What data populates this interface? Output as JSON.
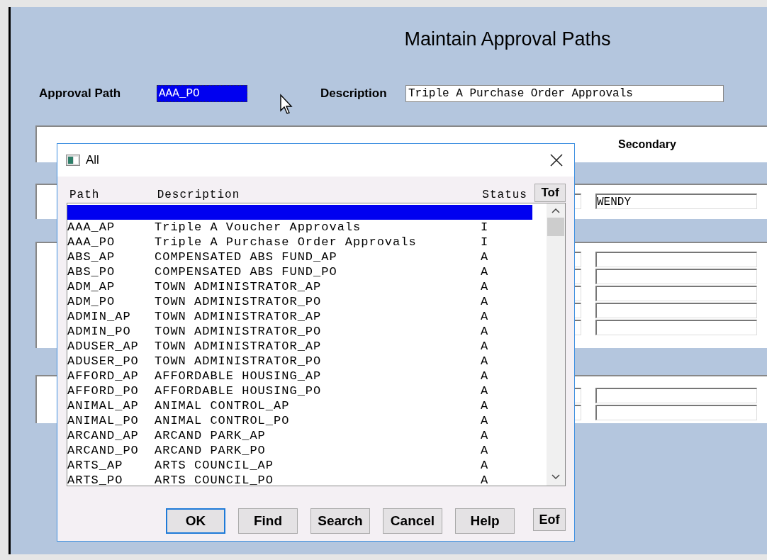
{
  "form": {
    "title": "Maintain Approval Paths",
    "approval_path": {
      "label": "Approval Path",
      "value": "AAA_PO",
      "selected": true
    },
    "description": {
      "label": "Description",
      "value": "Triple A Purchase Order Approvals"
    },
    "secondary_header": "Secondary",
    "secondary_value": "WENDY"
  },
  "dialog": {
    "title": "All",
    "columns": [
      "Path",
      "Description",
      "Status"
    ],
    "tof": "Tof",
    "rows": [
      {
        "selected": true
      },
      {
        "path": "AAA_AP",
        "description": "Triple A Voucher Approvals",
        "status": "I",
        "selected": false
      },
      {
        "path": "AAA_PO",
        "description": "Triple A Purchase Order Approvals",
        "status": "I",
        "selected": false
      },
      {
        "path": "ABS_AP",
        "description": "COMPENSATED ABS FUND_AP",
        "status": "A",
        "selected": false
      },
      {
        "path": "ABS_PO",
        "description": "COMPENSATED ABS FUND_PO",
        "status": "A",
        "selected": false
      },
      {
        "path": "ADM_AP",
        "description": "TOWN ADMINISTRATOR_AP",
        "status": "A",
        "selected": false
      },
      {
        "path": "ADM_PO",
        "description": "TOWN ADMINISTRATOR_PO",
        "status": "A",
        "selected": false
      },
      {
        "path": "ADMIN_AP",
        "description": "TOWN ADMINISTRATOR_AP",
        "status": "A",
        "selected": false
      },
      {
        "path": "ADMIN_PO",
        "description": "TOWN ADMINISTRATOR_PO",
        "status": "A",
        "selected": false
      },
      {
        "path": "ADUSER_AP",
        "description": "TOWN ADMINISTRATOR_AP",
        "status": "A",
        "selected": false
      },
      {
        "path": "ADUSER_PO",
        "description": "TOWN ADMINISTRATOR_PO",
        "status": "A",
        "selected": false
      },
      {
        "path": "AFFORD_AP",
        "description": "AFFORDABLE HOUSING_AP",
        "status": "A",
        "selected": false
      },
      {
        "path": "AFFORD_PO",
        "description": "AFFORDABLE HOUSING_PO",
        "status": "A",
        "selected": false
      },
      {
        "path": "ANIMAL_AP",
        "description": "ANIMAL CONTROL_AP",
        "status": "A",
        "selected": false
      },
      {
        "path": "ANIMAL_PO",
        "description": "ANIMAL CONTROL_PO",
        "status": "A",
        "selected": false
      },
      {
        "path": "ARCAND_AP",
        "description": "ARCAND PARK_AP",
        "status": "A",
        "selected": false
      },
      {
        "path": "ARCAND_PO",
        "description": "ARCAND PARK_PO",
        "status": "A",
        "selected": false
      },
      {
        "path": "ARTS_AP",
        "description": "ARTS COUNCIL_AP",
        "status": "A",
        "selected": false
      },
      {
        "path": "ARTS_PO",
        "description": "ARTS COUNCIL_PO",
        "status": "A",
        "selected": false
      }
    ],
    "buttons": [
      {
        "label": "OK",
        "default": true
      },
      {
        "label": "Find",
        "default": false
      },
      {
        "label": "Search",
        "default": false
      },
      {
        "label": "Cancel",
        "default": false
      },
      {
        "label": "Help",
        "default": false
      }
    ],
    "eof": "Eof"
  }
}
